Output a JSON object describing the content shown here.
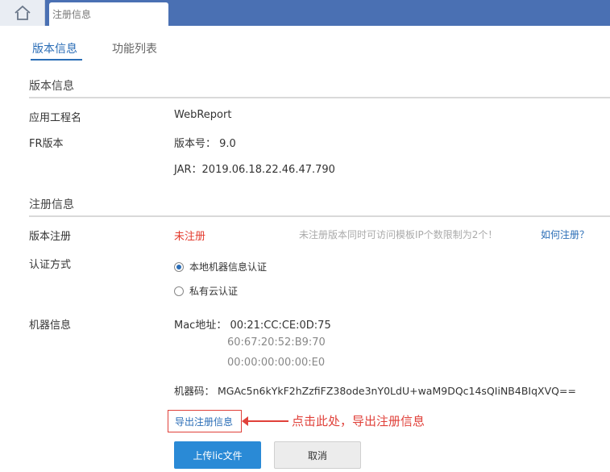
{
  "header": {
    "tab_label": "注册信息"
  },
  "subtabs": {
    "version_info": "版本信息",
    "feature_list": "功能列表"
  },
  "version_section": {
    "title": "版本信息",
    "app_name_label": "应用工程名",
    "app_name_value": "WebReport",
    "fr_version_label": "FR版本",
    "version_number": "版本号：  9.0",
    "jar_value": "JAR：2019.06.18.22.46.47.790"
  },
  "register_section": {
    "title": "注册信息",
    "version_register_label": "版本注册",
    "status": "未注册",
    "hint": "未注册版本同时可访问模板IP个数限制为2个！",
    "howto_link": "如何注册？",
    "auth_method_label": "认证方式",
    "auth_options": [
      {
        "label": "本地机器信息认证",
        "checked": true
      },
      {
        "label": "私有云认证",
        "checked": false
      }
    ],
    "machine_info_label": "机器信息",
    "mac_label": "Mac地址：  00:21:CC:CE:0D:75",
    "mac_2": "60:67:20:52:B9:70",
    "mac_3": "00:00:00:00:00:E0",
    "machine_code": "机器码：  MGAc5n6kYkF2hZzfiFZ38ode3nY0LdU+waM9DQc14sQIiNB4BIqXVQ==",
    "export_link": "导出注册信息",
    "annotation": "点击此处，导出注册信息",
    "upload_button": "上传lic文件",
    "cancel_button": "取消"
  },
  "colors": {
    "topbar": "#4a70b3",
    "accent": "#2a6db6",
    "error": "#e33b2e",
    "button_primary": "#2a8ad6"
  },
  "icons": {
    "home": "home-icon"
  }
}
